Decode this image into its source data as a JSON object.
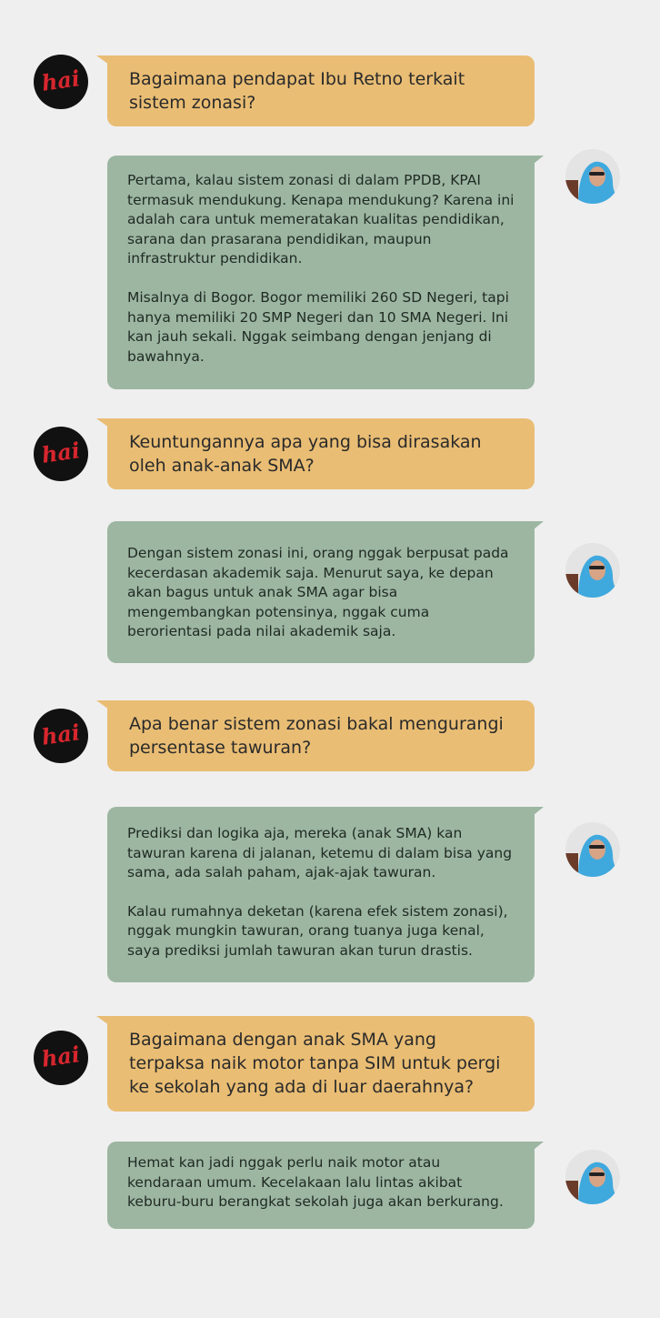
{
  "conversation": [
    {
      "role": "question",
      "text": "Bagaimana pendapat Ibu Retno terkait sistem zonasi?"
    },
    {
      "role": "answer",
      "paragraphs": [
        "Pertama, kalau sistem zonasi di dalam PPDB, KPAI termasuk mendukung. Kenapa mendukung? Karena ini adalah cara untuk memeratakan kualitas pendidikan, sarana dan prasarana pendidikan, maupun infrastruktur pendidikan.",
        "Misalnya di Bogor. Bogor memiliki 260 SD Negeri, tapi hanya memiliki 20 SMP Negeri dan 10 SMA Negeri. Ini kan jauh sekali. Nggak seimbang dengan jenjang di bawahnya."
      ]
    },
    {
      "role": "question",
      "text": "Keuntungannya apa yang bisa dirasakan oleh anak-anak SMA?"
    },
    {
      "role": "answer",
      "paragraphs": [
        "Dengan sistem zonasi ini, orang nggak berpusat pada kecerdasan akademik saja. Menurut saya, ke depan akan bagus untuk anak SMA agar bisa mengembangkan potensinya, nggak cuma berorientasi pada nilai akademik saja."
      ]
    },
    {
      "role": "question",
      "text": "Apa benar sistem zonasi bakal mengurangi persentase tawuran?"
    },
    {
      "role": "answer",
      "paragraphs": [
        "Prediksi dan logika aja, mereka (anak SMA) kan tawuran karena di jalanan, ketemu di dalam bisa yang sama, ada salah paham, ajak-ajak tawuran.",
        "Kalau rumahnya deketan (karena efek sistem zonasi), nggak mungkin tawuran, orang tuanya juga kenal, saya prediksi jumlah tawuran akan turun drastis."
      ]
    },
    {
      "role": "question",
      "text": "Bagaimana dengan anak SMA yang terpaksa naik motor tanpa SIM untuk pergi ke sekolah yang ada di luar daerahnya?"
    },
    {
      "role": "answer",
      "paragraphs": [
        "Hemat kan jadi nggak perlu naik motor atau kendaraan umum. Kecelakaan lalu lintas akibat keburu-buru berangkat sekolah juga akan berkurang."
      ]
    }
  ],
  "logo": {
    "text": "hai",
    "color": "#d7262e"
  },
  "colors": {
    "question_bubble": "#e9bd74",
    "answer_bubble": "#9db6a2",
    "background": "#efefef"
  }
}
